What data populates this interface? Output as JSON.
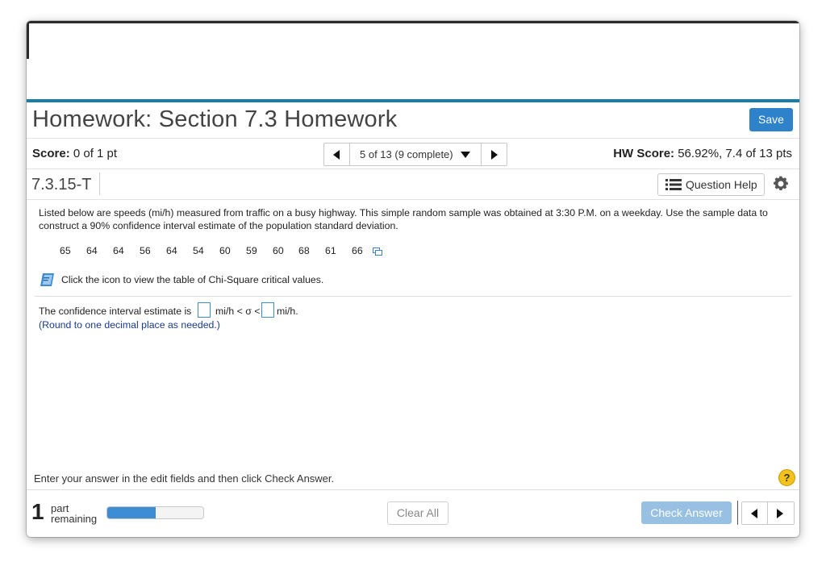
{
  "header": {
    "title": "Homework: Section 7.3 Homework",
    "save_label": "Save"
  },
  "score_bar": {
    "score_label": "Score:",
    "score_value": "0 of 1 pt",
    "navigator_text": "5 of 13 (9 complete)",
    "hw_score_label": "HW Score:",
    "hw_score_value": "56.92%, 7.4 of 13 pts"
  },
  "question": {
    "id": "7.3.15-T",
    "help_label": "Question Help",
    "problem_text": "Listed below are speeds (mi/h) measured from traffic on a busy highway. This simple random sample was obtained at 3:30 P.M. on a weekday. Use the sample data to construct a 90% confidence interval estimate of the population standard deviation.",
    "data_values": [
      "65",
      "64",
      "64",
      "56",
      "64",
      "54",
      "60",
      "59",
      "60",
      "68",
      "61",
      "66"
    ],
    "table_link_text": "Click the icon to view the table of Chi-Square critical values.",
    "answer_prefix": "The confidence interval estimate is",
    "answer_mid": "mi/h < σ <",
    "answer_suffix": "mi/h.",
    "lower_value": "",
    "upper_value": "",
    "round_note": "(Round to one decimal place as needed.)"
  },
  "footer": {
    "instruction": "Enter your answer in the edit fields and then click Check Answer.",
    "help_symbol": "?",
    "parts_number": "1",
    "parts_word": "part",
    "parts_remaining": "remaining",
    "progress_fraction": 0.5,
    "clear_label": "Clear All",
    "check_label": "Check Answer"
  },
  "colors": {
    "accent_rule": "#1a7ca8",
    "save_button": "#2d82c9",
    "progress_fill": "#3d8dd4",
    "check_button": "#97c0e3",
    "help_icon": "#f3c21d"
  },
  "icons": [
    "triangle-left-icon",
    "triangle-right-icon",
    "triangle-down-icon",
    "list-icon",
    "gear-icon",
    "copy-icon",
    "book-icon",
    "help-icon"
  ]
}
